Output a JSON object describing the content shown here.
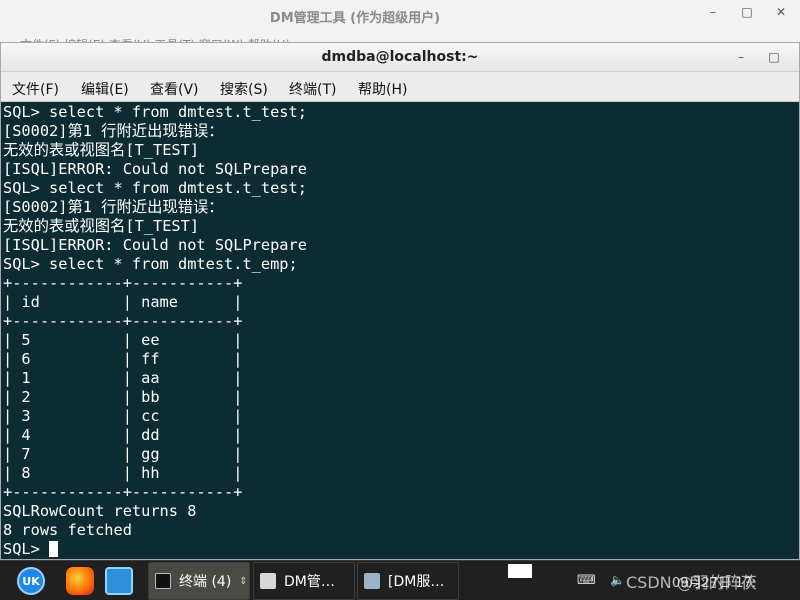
{
  "background_window": {
    "title": "DM管理工具 (作为超级用户)",
    "menu_hint": "文件(F)  编辑(E)  查看(V)  工具(T)  窗口(W)  帮助(H)"
  },
  "window_controls": {
    "minimize": "–",
    "maximize": "□",
    "close": "✕"
  },
  "terminal": {
    "title": "dmdba@localhost:~",
    "menu": [
      "文件(F)",
      "编辑(E)",
      "查看(V)",
      "搜索(S)",
      "终端(T)",
      "帮助(H)"
    ],
    "lines": [
      "SQL> select * from dmtest.t_test;",
      "[S0002]第1 行附近出现错误：",
      "无效的表或视图名[T_TEST]",
      "[ISQL]ERROR: Could not SQLPrepare",
      "SQL> select * from dmtest.t_test;",
      "[S0002]第1 行附近出现错误：",
      "无效的表或视图名[T_TEST]",
      "[ISQL]ERROR: Could not SQLPrepare",
      "SQL> select * from dmtest.t_emp;",
      "+------------+-----------+",
      "| id         | name      |",
      "+------------+-----------+",
      "| 5          | ee        |",
      "| 6          | ff        |",
      "| 1          | aa        |",
      "| 2          | bb        |",
      "| 3          | cc        |",
      "| 4          | dd        |",
      "| 7          | gg        |",
      "| 8          | hh        |",
      "+------------+-----------+",
      "SQLRowCount returns 8",
      "8 rows fetched",
      "SQL> "
    ]
  },
  "taskbar": {
    "launcher_icons": [
      {
        "name": "uk-icon",
        "label": "UK",
        "color": "#1e88e5"
      },
      {
        "name": "firefox-icon",
        "label": "",
        "color": "#ff7a18"
      },
      {
        "name": "file-manager-icon",
        "label": "",
        "color": "#2d8fd6"
      }
    ],
    "tasks": [
      {
        "label": "终端 (4)",
        "active": true
      },
      {
        "label": "DM管…",
        "active": false
      },
      {
        "label": "[DM服…",
        "active": false
      }
    ],
    "tray": {
      "keyboard": "⌨",
      "volume": "🔈",
      "time": "09月27日 17:"
    },
    "watermark": "CSDN @羽的阵茯"
  }
}
